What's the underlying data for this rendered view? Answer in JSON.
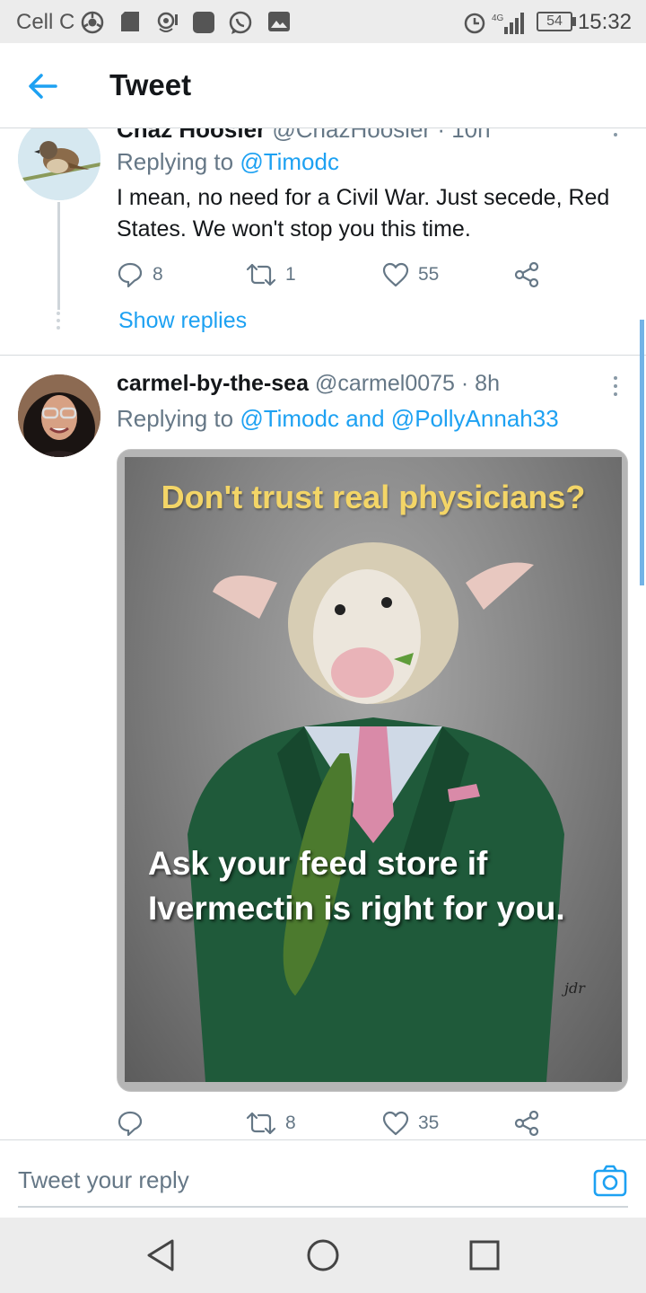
{
  "status_bar": {
    "carrier": "Cell C",
    "network": "4G",
    "battery": "54",
    "time": "15:32"
  },
  "header": {
    "title": "Tweet",
    "back_icon": "arrow-left-icon"
  },
  "tweets": [
    {
      "name": "Chaz Hoosier",
      "handle": "@ChazHoosier",
      "time": "· 10h",
      "replying_prefix": "Replying to",
      "replying_to": "@Timodc",
      "text": "I mean, no need for a Civil War. Just secede, Red States. We won't stop you this time.",
      "replies": "8",
      "retweets": "1",
      "likes": "55",
      "show_replies": "Show replies"
    },
    {
      "name": "carmel-by-the-sea",
      "handle": "@carmel0075",
      "time": "· 8h",
      "replying_prefix": "Replying to",
      "replying_to": "@Timodc and @PollyAnnah33",
      "media": {
        "top_text": "Don't trust real physicians?",
        "bottom_text": "Ask your feed store if Ivermectin is right for you.",
        "signature": "jdr"
      },
      "replies": "",
      "retweets": "8",
      "likes": "35"
    }
  ],
  "reply_bar": {
    "placeholder": "Tweet your reply"
  },
  "colors": {
    "accent": "#1da1f2",
    "secondary_text": "#657786",
    "meme_yellow": "#f3d567",
    "suit_green": "#1f5a3a"
  }
}
